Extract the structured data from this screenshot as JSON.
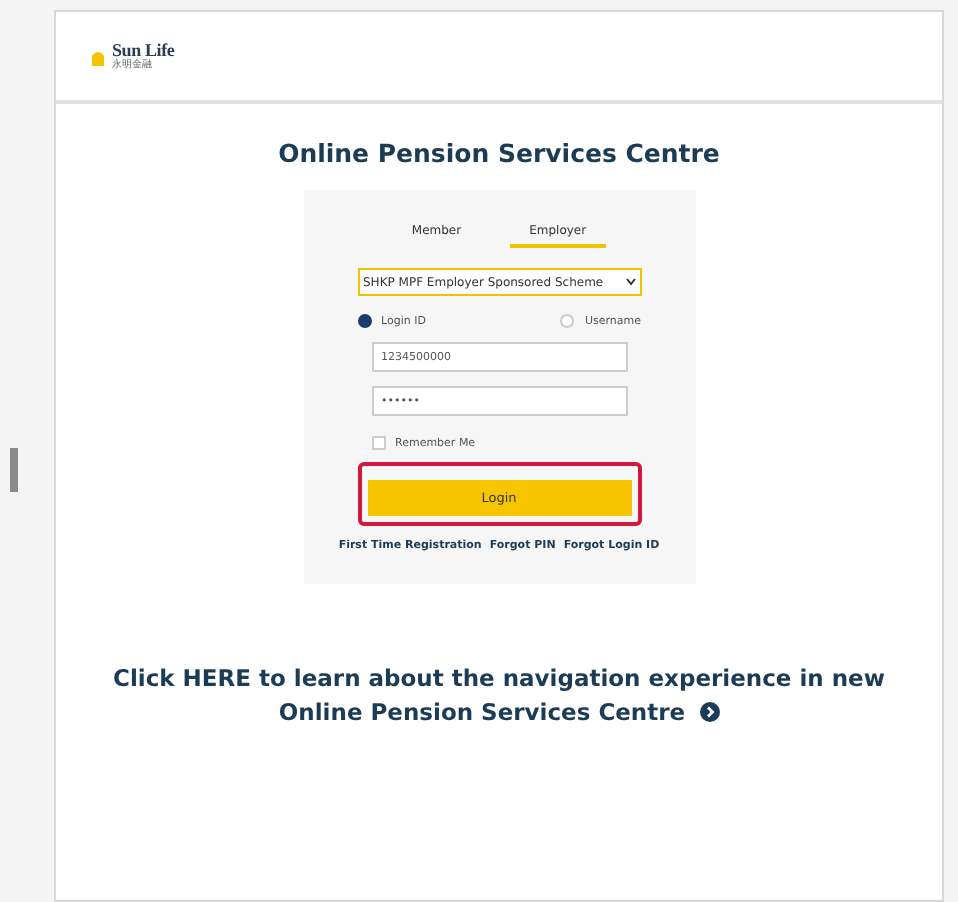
{
  "header": {
    "logo_text": "Sun Life",
    "logo_subtext": "永明金融"
  },
  "title": "Online Pension Services Centre",
  "tabs": [
    {
      "label": "Member",
      "selected": false
    },
    {
      "label": "Employer",
      "selected": true
    }
  ],
  "scheme_select": {
    "value": "SHKP MPF Employer Sponsored Scheme"
  },
  "login_type": [
    {
      "label": "Login ID",
      "selected": true
    },
    {
      "label": "Username",
      "selected": false
    }
  ],
  "login_id_field": {
    "value": "1234500000"
  },
  "password_field": {
    "value": "••••••"
  },
  "remember_me": {
    "label": "Remember Me",
    "checked": false
  },
  "login_button": {
    "label": "Login",
    "highlighted": true
  },
  "links": [
    "First Time Registration",
    "Forgot PIN",
    "Forgot Login ID"
  ],
  "info_link": {
    "line_1": "Click HERE to learn about the navigation experience in new",
    "line_2": "Online Pension Services Centre"
  }
}
